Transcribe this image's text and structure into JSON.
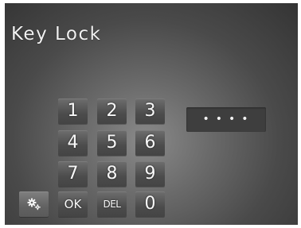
{
  "title": "Key Lock",
  "keypad": {
    "k1": "1",
    "k2": "2",
    "k3": "3",
    "k4": "4",
    "k5": "5",
    "k6": "6",
    "k7": "7",
    "k8": "8",
    "k9": "9",
    "k0": "0",
    "ok": "OK",
    "del": "DEL",
    "settings_icon": "gears-icon"
  },
  "pin_display": "••••"
}
